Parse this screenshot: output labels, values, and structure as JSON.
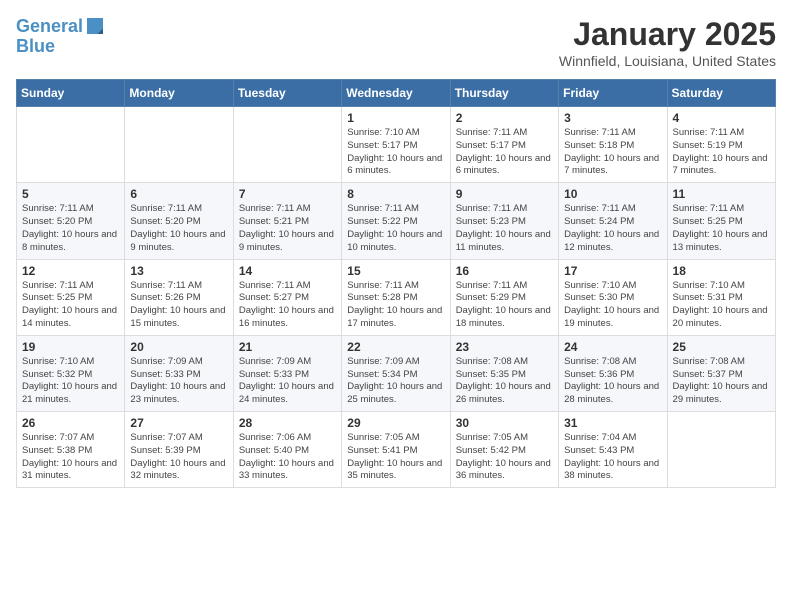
{
  "header": {
    "logo_line1": "General",
    "logo_line2": "Blue",
    "month": "January 2025",
    "location": "Winnfield, Louisiana, United States"
  },
  "weekdays": [
    "Sunday",
    "Monday",
    "Tuesday",
    "Wednesday",
    "Thursday",
    "Friday",
    "Saturday"
  ],
  "weeks": [
    [
      {
        "day": "",
        "sunrise": "",
        "sunset": "",
        "daylight": ""
      },
      {
        "day": "",
        "sunrise": "",
        "sunset": "",
        "daylight": ""
      },
      {
        "day": "",
        "sunrise": "",
        "sunset": "",
        "daylight": ""
      },
      {
        "day": "1",
        "sunrise": "Sunrise: 7:10 AM",
        "sunset": "Sunset: 5:17 PM",
        "daylight": "Daylight: 10 hours and 6 minutes."
      },
      {
        "day": "2",
        "sunrise": "Sunrise: 7:11 AM",
        "sunset": "Sunset: 5:17 PM",
        "daylight": "Daylight: 10 hours and 6 minutes."
      },
      {
        "day": "3",
        "sunrise": "Sunrise: 7:11 AM",
        "sunset": "Sunset: 5:18 PM",
        "daylight": "Daylight: 10 hours and 7 minutes."
      },
      {
        "day": "4",
        "sunrise": "Sunrise: 7:11 AM",
        "sunset": "Sunset: 5:19 PM",
        "daylight": "Daylight: 10 hours and 7 minutes."
      }
    ],
    [
      {
        "day": "5",
        "sunrise": "Sunrise: 7:11 AM",
        "sunset": "Sunset: 5:20 PM",
        "daylight": "Daylight: 10 hours and 8 minutes."
      },
      {
        "day": "6",
        "sunrise": "Sunrise: 7:11 AM",
        "sunset": "Sunset: 5:20 PM",
        "daylight": "Daylight: 10 hours and 9 minutes."
      },
      {
        "day": "7",
        "sunrise": "Sunrise: 7:11 AM",
        "sunset": "Sunset: 5:21 PM",
        "daylight": "Daylight: 10 hours and 9 minutes."
      },
      {
        "day": "8",
        "sunrise": "Sunrise: 7:11 AM",
        "sunset": "Sunset: 5:22 PM",
        "daylight": "Daylight: 10 hours and 10 minutes."
      },
      {
        "day": "9",
        "sunrise": "Sunrise: 7:11 AM",
        "sunset": "Sunset: 5:23 PM",
        "daylight": "Daylight: 10 hours and 11 minutes."
      },
      {
        "day": "10",
        "sunrise": "Sunrise: 7:11 AM",
        "sunset": "Sunset: 5:24 PM",
        "daylight": "Daylight: 10 hours and 12 minutes."
      },
      {
        "day": "11",
        "sunrise": "Sunrise: 7:11 AM",
        "sunset": "Sunset: 5:25 PM",
        "daylight": "Daylight: 10 hours and 13 minutes."
      }
    ],
    [
      {
        "day": "12",
        "sunrise": "Sunrise: 7:11 AM",
        "sunset": "Sunset: 5:25 PM",
        "daylight": "Daylight: 10 hours and 14 minutes."
      },
      {
        "day": "13",
        "sunrise": "Sunrise: 7:11 AM",
        "sunset": "Sunset: 5:26 PM",
        "daylight": "Daylight: 10 hours and 15 minutes."
      },
      {
        "day": "14",
        "sunrise": "Sunrise: 7:11 AM",
        "sunset": "Sunset: 5:27 PM",
        "daylight": "Daylight: 10 hours and 16 minutes."
      },
      {
        "day": "15",
        "sunrise": "Sunrise: 7:11 AM",
        "sunset": "Sunset: 5:28 PM",
        "daylight": "Daylight: 10 hours and 17 minutes."
      },
      {
        "day": "16",
        "sunrise": "Sunrise: 7:11 AM",
        "sunset": "Sunset: 5:29 PM",
        "daylight": "Daylight: 10 hours and 18 minutes."
      },
      {
        "day": "17",
        "sunrise": "Sunrise: 7:10 AM",
        "sunset": "Sunset: 5:30 PM",
        "daylight": "Daylight: 10 hours and 19 minutes."
      },
      {
        "day": "18",
        "sunrise": "Sunrise: 7:10 AM",
        "sunset": "Sunset: 5:31 PM",
        "daylight": "Daylight: 10 hours and 20 minutes."
      }
    ],
    [
      {
        "day": "19",
        "sunrise": "Sunrise: 7:10 AM",
        "sunset": "Sunset: 5:32 PM",
        "daylight": "Daylight: 10 hours and 21 minutes."
      },
      {
        "day": "20",
        "sunrise": "Sunrise: 7:09 AM",
        "sunset": "Sunset: 5:33 PM",
        "daylight": "Daylight: 10 hours and 23 minutes."
      },
      {
        "day": "21",
        "sunrise": "Sunrise: 7:09 AM",
        "sunset": "Sunset: 5:33 PM",
        "daylight": "Daylight: 10 hours and 24 minutes."
      },
      {
        "day": "22",
        "sunrise": "Sunrise: 7:09 AM",
        "sunset": "Sunset: 5:34 PM",
        "daylight": "Daylight: 10 hours and 25 minutes."
      },
      {
        "day": "23",
        "sunrise": "Sunrise: 7:08 AM",
        "sunset": "Sunset: 5:35 PM",
        "daylight": "Daylight: 10 hours and 26 minutes."
      },
      {
        "day": "24",
        "sunrise": "Sunrise: 7:08 AM",
        "sunset": "Sunset: 5:36 PM",
        "daylight": "Daylight: 10 hours and 28 minutes."
      },
      {
        "day": "25",
        "sunrise": "Sunrise: 7:08 AM",
        "sunset": "Sunset: 5:37 PM",
        "daylight": "Daylight: 10 hours and 29 minutes."
      }
    ],
    [
      {
        "day": "26",
        "sunrise": "Sunrise: 7:07 AM",
        "sunset": "Sunset: 5:38 PM",
        "daylight": "Daylight: 10 hours and 31 minutes."
      },
      {
        "day": "27",
        "sunrise": "Sunrise: 7:07 AM",
        "sunset": "Sunset: 5:39 PM",
        "daylight": "Daylight: 10 hours and 32 minutes."
      },
      {
        "day": "28",
        "sunrise": "Sunrise: 7:06 AM",
        "sunset": "Sunset: 5:40 PM",
        "daylight": "Daylight: 10 hours and 33 minutes."
      },
      {
        "day": "29",
        "sunrise": "Sunrise: 7:05 AM",
        "sunset": "Sunset: 5:41 PM",
        "daylight": "Daylight: 10 hours and 35 minutes."
      },
      {
        "day": "30",
        "sunrise": "Sunrise: 7:05 AM",
        "sunset": "Sunset: 5:42 PM",
        "daylight": "Daylight: 10 hours and 36 minutes."
      },
      {
        "day": "31",
        "sunrise": "Sunrise: 7:04 AM",
        "sunset": "Sunset: 5:43 PM",
        "daylight": "Daylight: 10 hours and 38 minutes."
      },
      {
        "day": "",
        "sunrise": "",
        "sunset": "",
        "daylight": ""
      }
    ]
  ]
}
